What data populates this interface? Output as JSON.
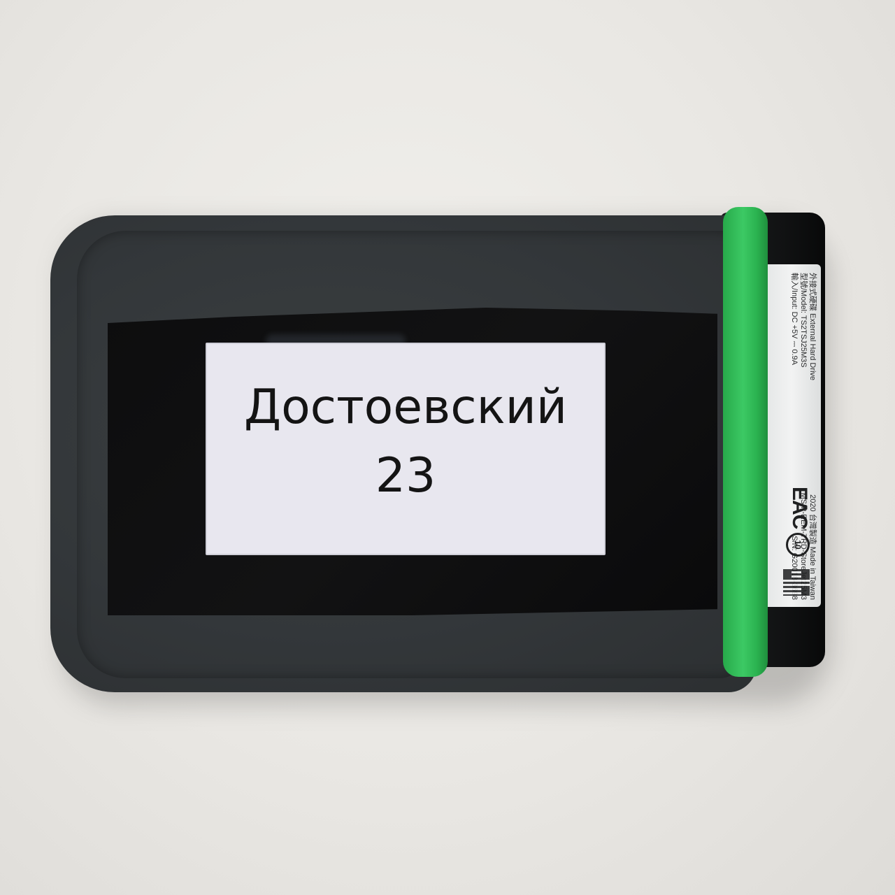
{
  "photo": {
    "background_color": "#e9e7e3",
    "drive_color": "#33373a",
    "band_color": "#3cc964"
  },
  "sticker": {
    "line1": "Достоевский",
    "line2": "23"
  },
  "device_label": {
    "row1": [
      "外接式硬碟 External Hard Drive",
      "2020 台灣製造 Made in Taiwan"
    ],
    "row2": [
      "型號/Model: TS2TSJ25M3S",
      "MSIP-REM-TRD-StoreJet25M3"
    ],
    "row3": [
      "輸入/Input: DC +5V ⎓ 0.9A",
      "S/N: G20018-3698"
    ],
    "eac_mark": "EAC",
    "recycle_mark": "10"
  }
}
